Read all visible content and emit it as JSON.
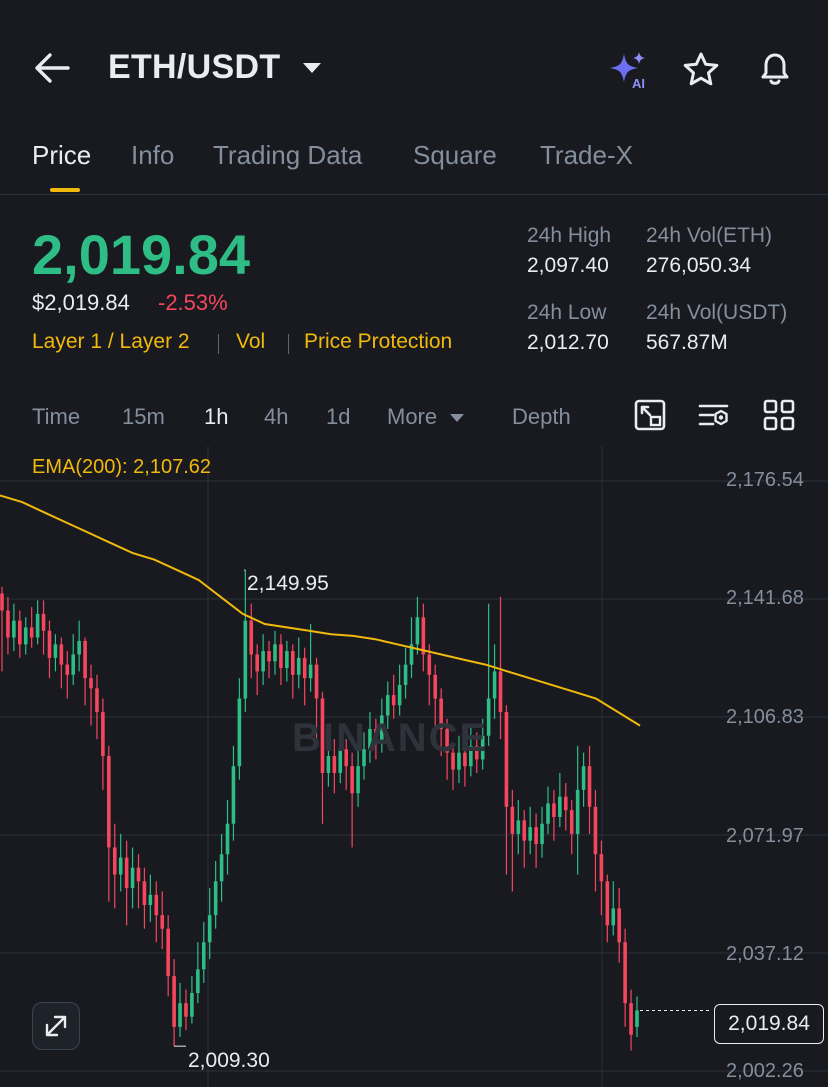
{
  "header": {
    "pair": "ETH/USDT",
    "icons": [
      "back-arrow-icon",
      "caret-down-icon",
      "ai-sparkle-icon",
      "star-icon",
      "bell-icon"
    ]
  },
  "tabs": [
    {
      "label": "Price",
      "active": true
    },
    {
      "label": "Info"
    },
    {
      "label": "Trading Data"
    },
    {
      "label": "Square"
    },
    {
      "label": "Trade-X"
    }
  ],
  "ticker": {
    "last_price": "2,019.84",
    "usd_price": "$2,019.84",
    "change": "-2.53%",
    "tags": [
      "Layer 1 / Layer 2",
      "Vol",
      "Price Protection"
    ],
    "high_label": "24h High",
    "high": "2,097.40",
    "vol_eth_label": "24h Vol(ETH)",
    "vol_eth": "276,050.34",
    "low_label": "24h Low",
    "low": "2,012.70",
    "vol_usdt_label": "24h Vol(USDT)",
    "vol_usdt": "567.87M"
  },
  "intervals": [
    "Time",
    "15m",
    "1h",
    "4h",
    "1d",
    "More",
    "Depth"
  ],
  "active_interval": "1h",
  "chart": {
    "ema_label": "EMA(200): 2,107.62",
    "price_axis": [
      "2,176.54",
      "2,141.68",
      "2,106.83",
      "2,071.97",
      "2,037.12",
      "2,002.26"
    ],
    "high_annotation": "2,149.95",
    "low_annotation": "2,009.30",
    "current_price": "2,019.84",
    "watermark": "BINANCE",
    "colors": {
      "up": "#2ebd85",
      "down": "#f6465d",
      "ema": "#f0b90b"
    }
  },
  "chart_data": {
    "type": "candlestick",
    "interval": "1h",
    "ylim": [
      2002.26,
      2176.54
    ],
    "y_ticks": [
      2176.54,
      2141.68,
      2106.83,
      2071.97,
      2037.12,
      2002.26
    ],
    "last": 2019.84,
    "high_marker": 2149.95,
    "low_marker": 2009.3,
    "ema200_last": 2107.62,
    "candles": [
      [
        2143,
        2138,
        2145,
        2120
      ],
      [
        2138,
        2130,
        2142,
        2125
      ],
      [
        2130,
        2135,
        2140,
        2126
      ],
      [
        2135,
        2128,
        2138,
        2124
      ],
      [
        2128,
        2133,
        2136,
        2125
      ],
      [
        2133,
        2130,
        2139,
        2127
      ],
      [
        2130,
        2137,
        2141,
        2128
      ],
      [
        2137,
        2132,
        2141,
        2125
      ],
      [
        2132,
        2124,
        2135,
        2118
      ],
      [
        2124,
        2128,
        2131,
        2120
      ],
      [
        2128,
        2122,
        2130,
        2115
      ],
      [
        2122,
        2119,
        2126,
        2112
      ],
      [
        2119,
        2125,
        2131,
        2116
      ],
      [
        2125,
        2129,
        2135,
        2120
      ],
      [
        2129,
        2118,
        2130,
        2110
      ],
      [
        2118,
        2115,
        2122,
        2104
      ],
      [
        2115,
        2108,
        2119,
        2100
      ],
      [
        2108,
        2095,
        2112,
        2085
      ],
      [
        2095,
        2068,
        2098,
        2052
      ],
      [
        2068,
        2060,
        2075,
        2050
      ],
      [
        2060,
        2065,
        2072,
        2055
      ],
      [
        2065,
        2056,
        2070,
        2045
      ],
      [
        2056,
        2062,
        2068,
        2050
      ],
      [
        2062,
        2058,
        2066,
        2050
      ],
      [
        2058,
        2051,
        2062,
        2044
      ],
      [
        2051,
        2054,
        2060,
        2046
      ],
      [
        2054,
        2048,
        2058,
        2040
      ],
      [
        2048,
        2044,
        2055,
        2038
      ],
      [
        2044,
        2030,
        2048,
        2024
      ],
      [
        2030,
        2015,
        2035,
        2009.3
      ],
      [
        2015,
        2022,
        2028,
        2012
      ],
      [
        2022,
        2018,
        2026,
        2014
      ],
      [
        2018,
        2025,
        2030,
        2016
      ],
      [
        2025,
        2032,
        2040,
        2022
      ],
      [
        2032,
        2040,
        2046,
        2028
      ],
      [
        2040,
        2048,
        2056,
        2035
      ],
      [
        2048,
        2058,
        2064,
        2044
      ],
      [
        2058,
        2066,
        2072,
        2052
      ],
      [
        2066,
        2075,
        2082,
        2060
      ],
      [
        2075,
        2092,
        2098,
        2070
      ],
      [
        2092,
        2112,
        2118,
        2088
      ],
      [
        2112,
        2135,
        2149.95,
        2108
      ],
      [
        2135,
        2125,
        2140,
        2118
      ],
      [
        2125,
        2120,
        2128,
        2113
      ],
      [
        2120,
        2126,
        2131,
        2116
      ],
      [
        2126,
        2123,
        2129,
        2118
      ],
      [
        2123,
        2128,
        2132,
        2119
      ],
      [
        2128,
        2121,
        2131,
        2116
      ],
      [
        2121,
        2126,
        2129,
        2117
      ],
      [
        2126,
        2119,
        2128,
        2112
      ],
      [
        2119,
        2124,
        2130,
        2115
      ],
      [
        2124,
        2118,
        2127,
        2110
      ],
      [
        2118,
        2122,
        2134,
        2114
      ],
      [
        2122,
        2112,
        2124,
        2100
      ],
      [
        2112,
        2090,
        2114,
        2075
      ],
      [
        2090,
        2095,
        2102,
        2086
      ],
      [
        2095,
        2090,
        2100,
        2084
      ],
      [
        2090,
        2097,
        2104,
        2087
      ],
      [
        2097,
        2092,
        2100,
        2085
      ],
      [
        2092,
        2084,
        2096,
        2068
      ],
      [
        2084,
        2092,
        2098,
        2080
      ],
      [
        2092,
        2097,
        2102,
        2088
      ],
      [
        2097,
        2103,
        2108,
        2093
      ],
      [
        2103,
        2099,
        2106,
        2094
      ],
      [
        2099,
        2107,
        2112,
        2096
      ],
      [
        2107,
        2113,
        2117,
        2103
      ],
      [
        2113,
        2110,
        2119,
        2106
      ],
      [
        2110,
        2116,
        2122,
        2107
      ],
      [
        2116,
        2122,
        2127,
        2112
      ],
      [
        2122,
        2128,
        2136,
        2118
      ],
      [
        2128,
        2136,
        2142,
        2125
      ],
      [
        2136,
        2125,
        2140,
        2120
      ],
      [
        2125,
        2119,
        2128,
        2110
      ],
      [
        2119,
        2112,
        2122,
        2102
      ],
      [
        2112,
        2103,
        2115,
        2095
      ],
      [
        2103,
        2096,
        2106,
        2088
      ],
      [
        2096,
        2091,
        2099,
        2085
      ],
      [
        2091,
        2096,
        2101,
        2087
      ],
      [
        2096,
        2092,
        2099,
        2086
      ],
      [
        2092,
        2098,
        2104,
        2089
      ],
      [
        2098,
        2094,
        2102,
        2090
      ],
      [
        2094,
        2101,
        2106,
        2091
      ],
      [
        2101,
        2112,
        2140,
        2098
      ],
      [
        2112,
        2120,
        2128,
        2106
      ],
      [
        2120,
        2108,
        2142,
        2100
      ],
      [
        2108,
        2080,
        2110,
        2060
      ],
      [
        2080,
        2072,
        2085,
        2055
      ],
      [
        2072,
        2076,
        2082,
        2066
      ],
      [
        2076,
        2070,
        2079,
        2062
      ],
      [
        2070,
        2074,
        2080,
        2066
      ],
      [
        2074,
        2069,
        2078,
        2062
      ],
      [
        2069,
        2075,
        2080,
        2065
      ],
      [
        2075,
        2081,
        2086,
        2072
      ],
      [
        2081,
        2077,
        2085,
        2070
      ],
      [
        2077,
        2083,
        2090,
        2074
      ],
      [
        2083,
        2079,
        2087,
        2073
      ],
      [
        2079,
        2072,
        2082,
        2066
      ],
      [
        2072,
        2085,
        2098,
        2060
      ],
      [
        2085,
        2092,
        2096,
        2080
      ],
      [
        2092,
        2080,
        2098,
        2072
      ],
      [
        2080,
        2066,
        2085,
        2055
      ],
      [
        2066,
        2058,
        2070,
        2048
      ],
      [
        2058,
        2045,
        2060,
        2040
      ],
      [
        2045,
        2050,
        2058,
        2042
      ],
      [
        2050,
        2040,
        2056,
        2034
      ],
      [
        2040,
        2022,
        2044,
        2015
      ],
      [
        2022,
        2012.7,
        2026,
        2008
      ],
      [
        2015,
        2019.84,
        2024,
        2012
      ]
    ],
    "ema200": [
      2172,
      2170,
      2167,
      2164,
      2161,
      2158,
      2155,
      2153,
      2150,
      2147,
      2142,
      2137,
      2134,
      2133,
      2132,
      2131,
      2130.5,
      2129.5,
      2128,
      2126.5,
      2125,
      2123.5,
      2122,
      2120,
      2118,
      2116,
      2114,
      2112,
      2108,
      2104
    ]
  }
}
